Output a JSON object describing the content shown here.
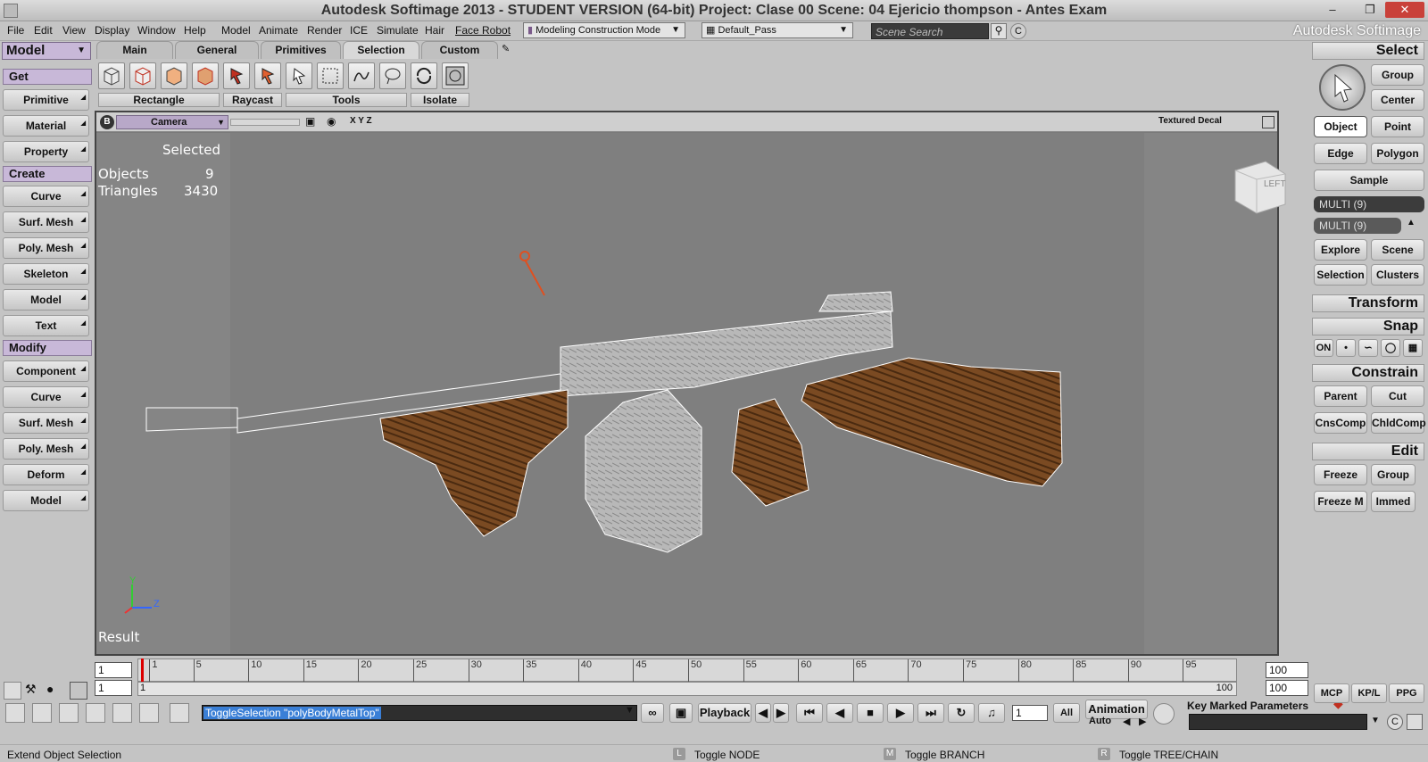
{
  "window": {
    "title": "Autodesk Softimage 2013  - STUDENT VERSION (64-bit)      Project: Clase 00      Scene: 04 Ejericio thompson - Antes Exam",
    "brand": "Autodesk Softimage"
  },
  "menu": [
    "File",
    "Edit",
    "View",
    "Display",
    "Window",
    "Help",
    "Model",
    "Animate",
    "Render",
    "ICE",
    "Simulate",
    "Hair",
    "Face Robot"
  ],
  "mode_dropdown": "Modeling Construction Mode",
  "pass_dropdown": "Default_Pass",
  "search": {
    "placeholder": "Scene Search"
  },
  "left": {
    "module": "Model",
    "get_header": "Get",
    "get_items": [
      "Primitive",
      "Material",
      "Property"
    ],
    "create_header": "Create",
    "create_items": [
      "Curve",
      "Surf. Mesh",
      "Poly. Mesh",
      "Skeleton",
      "Model",
      "Text"
    ],
    "modify_header": "Modify",
    "modify_items": [
      "Component",
      "Curve",
      "Surf. Mesh",
      "Poly. Mesh",
      "Deform",
      "Model"
    ]
  },
  "tabs": [
    "Main",
    "General",
    "Primitives",
    "Selection",
    "Custom"
  ],
  "tool_labels": [
    "Rectangle",
    "Raycast",
    "Tools",
    "Isolate"
  ],
  "viewport": {
    "camera": "Camera",
    "axes": "X Y Z",
    "shading": "Textured Decal",
    "cube_label": "LEFT",
    "stats_title": "Selected",
    "objects_label": "Objects",
    "objects_value": "9",
    "triangles_label": "Triangles",
    "triangles_value": "3430",
    "result_label": "Result",
    "axis_y": "Y",
    "axis_z": "Z"
  },
  "right": {
    "select_header": "Select",
    "group": "Group",
    "center": "Center",
    "object": "Object",
    "point": "Point",
    "edge": "Edge",
    "polygon": "Polygon",
    "sample": "Sample",
    "multi1": "MULTI (9)",
    "multi2": "MULTI (9)",
    "explore": "Explore",
    "scene": "Scene",
    "selection": "Selection",
    "clusters": "Clusters",
    "transform_header": "Transform",
    "snap_header": "Snap",
    "snap_on": "ON",
    "constrain_header": "Constrain",
    "parent": "Parent",
    "cut": "Cut",
    "cnscomp": "CnsComp",
    "chldcomp": "ChldComp",
    "edit_header": "Edit",
    "freeze": "Freeze",
    "group2": "Group",
    "freezem": "Freeze M",
    "immed": "Immed"
  },
  "timeline": {
    "start": "1",
    "start2": "1",
    "end": "100",
    "end2": "100",
    "end_label": "100",
    "ticks": [
      "1",
      "5",
      "10",
      "15",
      "20",
      "25",
      "30",
      "35",
      "40",
      "45",
      "50",
      "55",
      "60",
      "65",
      "70",
      "75",
      "80",
      "85",
      "90",
      "95"
    ]
  },
  "bottom": {
    "command": "ToggleSelection \"polyBodyMetalTop\"",
    "playback": "Playback",
    "frame": "1",
    "all": "All",
    "animation": "Animation",
    "auto": "Auto",
    "key_marked": "Key Marked Parameters",
    "mcp": "MCP",
    "kpl": "KP/L",
    "ppg": "PPG"
  },
  "status": {
    "message": "Extend Object Selection",
    "l_key": "L",
    "l_text": "Toggle NODE",
    "m_key": "M",
    "m_text": "Toggle BRANCH",
    "r_key": "R",
    "r_text": "Toggle TREE/CHAIN"
  }
}
